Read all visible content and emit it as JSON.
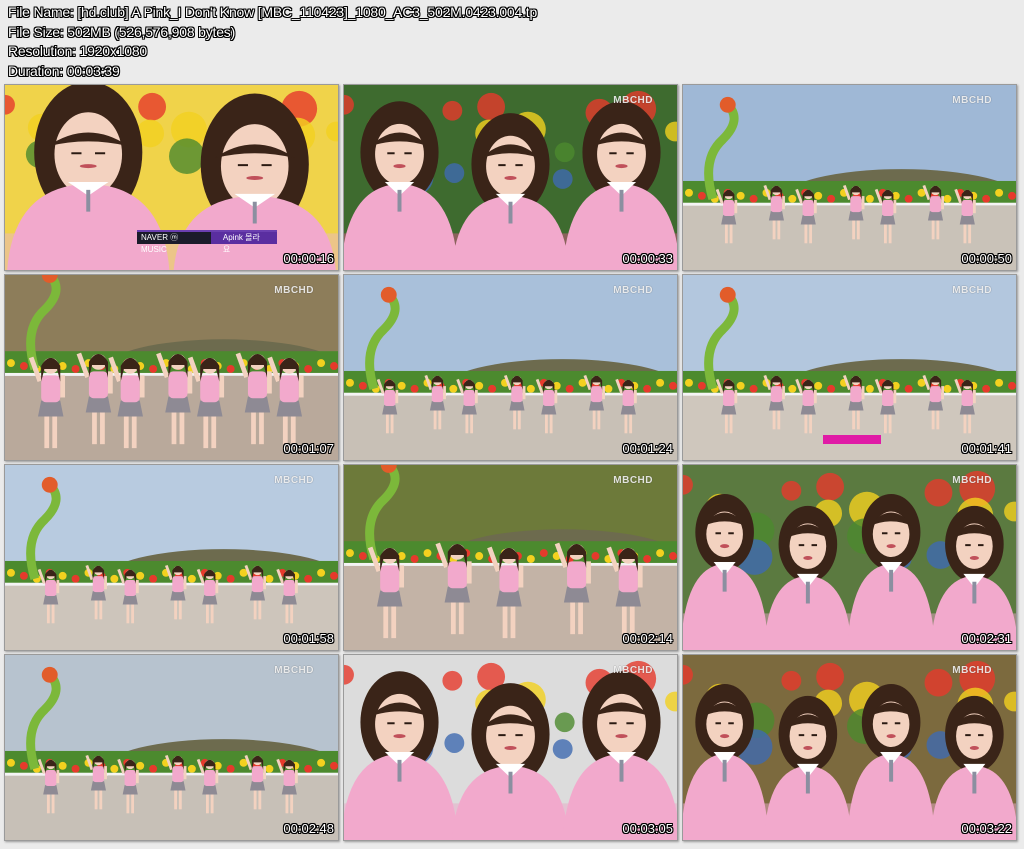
{
  "info": {
    "file_name": "File Name: [hd.club] A Pink_I Don't Know [MBC_110423]_1080_AC3_502M.0423.004.tp",
    "file_size": "File Size: 502MB (526,576,908 bytes)",
    "resolution": "Resolution: 1920x1080",
    "duration": "Duration: 00:03:39"
  },
  "overlay": {
    "logo_text": "MBCHD",
    "caption_left": "NAVER ⓜ MUSIC",
    "caption_right": "Apink 몰라요"
  },
  "thumbnails": [
    {
      "time": "00:00:16",
      "scene": "closeup",
      "sky": "#f0d34a",
      "ground": "#e8b7c6",
      "dancers": 2,
      "has_caption_bar": true
    },
    {
      "time": "00:00:33",
      "scene": "closeup",
      "sky": "#3e6b2f",
      "ground": "#d85a8a",
      "dancers": 3
    },
    {
      "time": "00:00:50",
      "scene": "wide",
      "sky": "#9fb8d6",
      "ground": "#c9c2b8",
      "dancers": 7
    },
    {
      "time": "00:01:07",
      "scene": "medium",
      "sky": "#8d7d5a",
      "ground": "#b9a99b",
      "dancers": 7
    },
    {
      "time": "00:01:24",
      "scene": "wide",
      "sky": "#a9c0da",
      "ground": "#c8c0b6",
      "dancers": 7
    },
    {
      "time": "00:01:41",
      "scene": "wide",
      "sky": "#b3c7de",
      "ground": "#cfc7bd",
      "dancers": 7,
      "has_pink_caption": true
    },
    {
      "time": "00:01:58",
      "scene": "wide",
      "sky": "#b8cbe0",
      "ground": "#cdc5bb",
      "dancers": 7
    },
    {
      "time": "00:02:14",
      "scene": "medium",
      "sky": "#6d7a3a",
      "ground": "#c3b3a6",
      "dancers": 5
    },
    {
      "time": "00:02:31",
      "scene": "closeup",
      "sky": "#5b7a40",
      "ground": "#e6a2c2",
      "dancers": 4
    },
    {
      "time": "00:02:48",
      "scene": "wide",
      "sky": "#b7c3cf",
      "ground": "#c7c0b7",
      "dancers": 7
    },
    {
      "time": "00:03:05",
      "scene": "closeup",
      "sky": "#dcdcdc",
      "ground": "#e7a7c5",
      "dancers": 3
    },
    {
      "time": "00:03:22",
      "scene": "closeup",
      "sky": "#7c6a3e",
      "ground": "#e9a9c8",
      "dancers": 4
    }
  ],
  "colors": {
    "uniform_pink": "#f2a9cc",
    "skirt_gray": "#8e8a94",
    "hair": "#3a2418",
    "skin": "#f3d2c0",
    "flowers_a": "#e63a2c",
    "flowers_b": "#f3d11f",
    "foliage": "#4c8a2e"
  }
}
